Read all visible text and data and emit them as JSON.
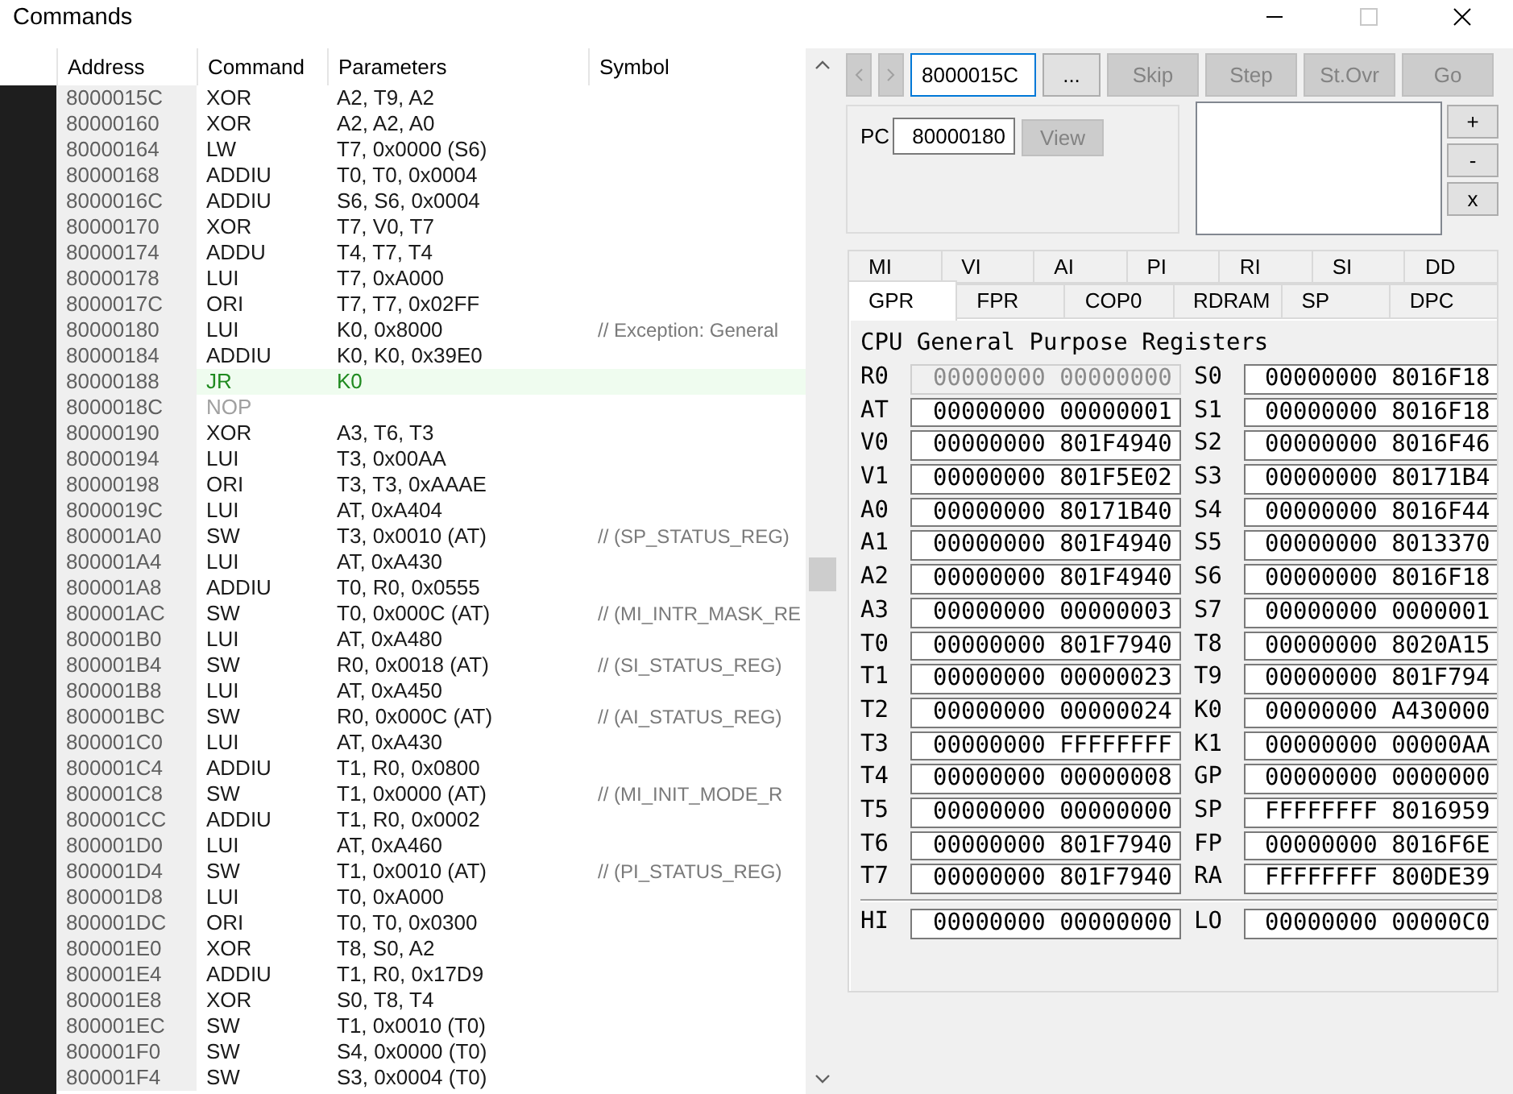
{
  "window": {
    "title": "Commands",
    "controls": [
      {
        "kind": "minimize",
        "disabled": false
      },
      {
        "kind": "maximize",
        "disabled": true
      },
      {
        "kind": "close",
        "disabled": false
      }
    ]
  },
  "commands_table": {
    "columns": [
      "Address",
      "Command",
      "Parameters",
      "Symbol"
    ],
    "rows": [
      {
        "address": "8000015C",
        "command": "XOR",
        "parameters": "A2, T9, A2",
        "kind": "normal"
      },
      {
        "address": "80000160",
        "command": "XOR",
        "parameters": "A2, A2, A0",
        "kind": "normal"
      },
      {
        "address": "80000164",
        "command": "LW",
        "parameters": "T7, 0x0000 (S6)",
        "kind": "normal"
      },
      {
        "address": "80000168",
        "command": "ADDIU",
        "parameters": "T0, T0, 0x0004",
        "kind": "normal"
      },
      {
        "address": "8000016C",
        "command": "ADDIU",
        "parameters": "S6, S6, 0x0004",
        "kind": "normal"
      },
      {
        "address": "80000170",
        "command": "XOR",
        "parameters": "T7, V0, T7",
        "kind": "normal"
      },
      {
        "address": "80000174",
        "command": "ADDU",
        "parameters": "T4, T7, T4",
        "kind": "normal"
      },
      {
        "address": "80000178",
        "command": "LUI",
        "parameters": "T7, 0xA000",
        "kind": "normal"
      },
      {
        "address": "8000017C",
        "command": "ORI",
        "parameters": "T7, T7, 0x02FF",
        "kind": "normal"
      },
      {
        "address": "80000180",
        "command": "LUI",
        "parameters": "K0, 0x8000",
        "symbol": "// Exception: General",
        "kind": "normal"
      },
      {
        "address": "80000184",
        "command": "ADDIU",
        "parameters": "K0, K0, 0x39E0",
        "kind": "normal"
      },
      {
        "address": "80000188",
        "command": "JR",
        "parameters": "K0",
        "kind": "jump"
      },
      {
        "address": "8000018C",
        "command": "NOP",
        "kind": "nop"
      },
      {
        "address": "80000190",
        "command": "XOR",
        "parameters": "A3, T6, T3",
        "kind": "normal"
      },
      {
        "address": "80000194",
        "command": "LUI",
        "parameters": "T3, 0x00AA",
        "kind": "normal"
      },
      {
        "address": "80000198",
        "command": "ORI",
        "parameters": "T3, T3, 0xAAAE",
        "kind": "normal"
      },
      {
        "address": "8000019C",
        "command": "LUI",
        "parameters": "AT, 0xA404",
        "kind": "normal"
      },
      {
        "address": "800001A0",
        "command": "SW",
        "parameters": "T3, 0x0010 (AT)",
        "symbol": "// (SP_STATUS_REG)",
        "kind": "normal"
      },
      {
        "address": "800001A4",
        "command": "LUI",
        "parameters": "AT, 0xA430",
        "kind": "normal"
      },
      {
        "address": "800001A8",
        "command": "ADDIU",
        "parameters": "T0, R0, 0x0555",
        "kind": "normal"
      },
      {
        "address": "800001AC",
        "command": "SW",
        "parameters": "T0, 0x000C (AT)",
        "symbol": "// (MI_INTR_MASK_RE",
        "kind": "normal"
      },
      {
        "address": "800001B0",
        "command": "LUI",
        "parameters": "AT, 0xA480",
        "kind": "normal"
      },
      {
        "address": "800001B4",
        "command": "SW",
        "parameters": "R0, 0x0018 (AT)",
        "symbol": "// (SI_STATUS_REG)",
        "kind": "normal"
      },
      {
        "address": "800001B8",
        "command": "LUI",
        "parameters": "AT, 0xA450",
        "kind": "normal"
      },
      {
        "address": "800001BC",
        "command": "SW",
        "parameters": "R0, 0x000C (AT)",
        "symbol": "// (AI_STATUS_REG)",
        "kind": "normal"
      },
      {
        "address": "800001C0",
        "command": "LUI",
        "parameters": "AT, 0xA430",
        "kind": "normal"
      },
      {
        "address": "800001C4",
        "command": "ADDIU",
        "parameters": "T1, R0, 0x0800",
        "kind": "normal"
      },
      {
        "address": "800001C8",
        "command": "SW",
        "parameters": "T1, 0x0000 (AT)",
        "symbol": "// (MI_INIT_MODE_R",
        "kind": "normal"
      },
      {
        "address": "800001CC",
        "command": "ADDIU",
        "parameters": "T1, R0, 0x0002",
        "kind": "normal"
      },
      {
        "address": "800001D0",
        "command": "LUI",
        "parameters": "AT, 0xA460",
        "kind": "normal"
      },
      {
        "address": "800001D4",
        "command": "SW",
        "parameters": "T1, 0x0010 (AT)",
        "symbol": "// (PI_STATUS_REG)",
        "kind": "normal"
      },
      {
        "address": "800001D8",
        "command": "LUI",
        "parameters": "T0, 0xA000",
        "kind": "normal"
      },
      {
        "address": "800001DC",
        "command": "ORI",
        "parameters": "T0, T0, 0x0300",
        "kind": "normal"
      },
      {
        "address": "800001E0",
        "command": "XOR",
        "parameters": "T8, S0, A2",
        "kind": "normal"
      },
      {
        "address": "800001E4",
        "command": "ADDIU",
        "parameters": "T1, R0, 0x17D9",
        "kind": "normal"
      },
      {
        "address": "800001E8",
        "command": "XOR",
        "parameters": "S0, T8, T4",
        "kind": "normal"
      },
      {
        "address": "800001EC",
        "command": "SW",
        "parameters": "T1, 0x0010 (T0)",
        "kind": "normal"
      },
      {
        "address": "800001F0",
        "command": "SW",
        "parameters": "S4, 0x0000 (T0)",
        "kind": "normal"
      },
      {
        "address": "800001F4",
        "command": "SW",
        "parameters": "S3, 0x0004 (T0)",
        "kind": "normal"
      }
    ]
  },
  "toolbar": {
    "nav_buttons": [
      {
        "kind": "back",
        "disabled": true
      },
      {
        "kind": "forward",
        "disabled": true
      }
    ],
    "address_field": {
      "value": "8000015C"
    },
    "buttons": [
      {
        "label": "...",
        "kind": "browse",
        "disabled": false
      },
      {
        "label": "Skip",
        "kind": "action",
        "disabled": true
      },
      {
        "label": "Step",
        "kind": "action",
        "disabled": true
      },
      {
        "label": "St.Ovr",
        "kind": "action",
        "disabled": true
      },
      {
        "label": "Go",
        "kind": "action",
        "disabled": true
      }
    ]
  },
  "pc_group": {
    "label": "PC",
    "value": "80000180",
    "view_button": {
      "label": "View",
      "disabled": true
    }
  },
  "breakpoint_buttons": [
    {
      "label": "+"
    },
    {
      "label": "-"
    },
    {
      "label": "x"
    }
  ],
  "tab_rows": [
    {
      "tabs": [
        {
          "label": "MI",
          "selected": false
        },
        {
          "label": "VI",
          "selected": false
        },
        {
          "label": "AI",
          "selected": false
        },
        {
          "label": "PI",
          "selected": false
        },
        {
          "label": "RI",
          "selected": false
        },
        {
          "label": "SI",
          "selected": false
        },
        {
          "label": "DD",
          "selected": false
        }
      ]
    },
    {
      "tabs": [
        {
          "label": "GPR",
          "selected": true
        },
        {
          "label": "FPR",
          "selected": false
        },
        {
          "label": "COP0",
          "selected": false
        },
        {
          "label": "RDRAM",
          "selected": false
        },
        {
          "label": "SP",
          "selected": false
        },
        {
          "label": "DPC",
          "selected": false
        }
      ]
    }
  ],
  "gpr_panel": {
    "title": "CPU General Purpose Registers",
    "left_registers": [
      {
        "name": "R0",
        "value": "00000000 00000000",
        "disabled": true
      },
      {
        "name": "AT",
        "value": "00000000 00000001",
        "disabled": false
      },
      {
        "name": "V0",
        "value": "00000000 801F4940",
        "disabled": false
      },
      {
        "name": "V1",
        "value": "00000000 801F5E02",
        "disabled": false
      },
      {
        "name": "A0",
        "value": "00000000 80171B40",
        "disabled": false
      },
      {
        "name": "A1",
        "value": "00000000 801F4940",
        "disabled": false
      },
      {
        "name": "A2",
        "value": "00000000 801F4940",
        "disabled": false
      },
      {
        "name": "A3",
        "value": "00000000 00000003",
        "disabled": false
      },
      {
        "name": "T0",
        "value": "00000000 801F7940",
        "disabled": false
      },
      {
        "name": "T1",
        "value": "00000000 00000023",
        "disabled": false
      },
      {
        "name": "T2",
        "value": "00000000 00000024",
        "disabled": false
      },
      {
        "name": "T3",
        "value": "00000000 FFFFFFFF",
        "disabled": false
      },
      {
        "name": "T4",
        "value": "00000000 00000008",
        "disabled": false
      },
      {
        "name": "T5",
        "value": "00000000 00000000",
        "disabled": false
      },
      {
        "name": "T6",
        "value": "00000000 801F7940",
        "disabled": false
      },
      {
        "name": "T7",
        "value": "00000000 801F7940",
        "disabled": false
      }
    ],
    "right_registers": [
      {
        "name": "S0",
        "value": "00000000 8016F18",
        "disabled": false
      },
      {
        "name": "S1",
        "value": "00000000 8016F18",
        "disabled": false
      },
      {
        "name": "S2",
        "value": "00000000 8016F46",
        "disabled": false
      },
      {
        "name": "S3",
        "value": "00000000 80171B4",
        "disabled": false
      },
      {
        "name": "S4",
        "value": "00000000 8016F44",
        "disabled": false
      },
      {
        "name": "S5",
        "value": "00000000 8013370",
        "disabled": false
      },
      {
        "name": "S6",
        "value": "00000000 8016F18",
        "disabled": false
      },
      {
        "name": "S7",
        "value": "00000000 0000001",
        "disabled": false
      },
      {
        "name": "T8",
        "value": "00000000 8020A15",
        "disabled": false
      },
      {
        "name": "T9",
        "value": "00000000 801F794",
        "disabled": false
      },
      {
        "name": "K0",
        "value": "00000000 A430000",
        "disabled": false
      },
      {
        "name": "K1",
        "value": "00000000 00000AA",
        "disabled": false
      },
      {
        "name": "GP",
        "value": "00000000 0000000",
        "disabled": false
      },
      {
        "name": "SP",
        "value": "FFFFFFFF 8016959",
        "disabled": false
      },
      {
        "name": "FP",
        "value": "00000000 8016F6E",
        "disabled": false
      },
      {
        "name": "RA",
        "value": "FFFFFFFF 800DE39",
        "disabled": false
      }
    ],
    "hi_lo": [
      {
        "name": "HI",
        "value": "00000000 00000000",
        "disabled": false
      },
      {
        "name": "LO",
        "value": "00000000 00000C0",
        "disabled": false
      }
    ]
  }
}
